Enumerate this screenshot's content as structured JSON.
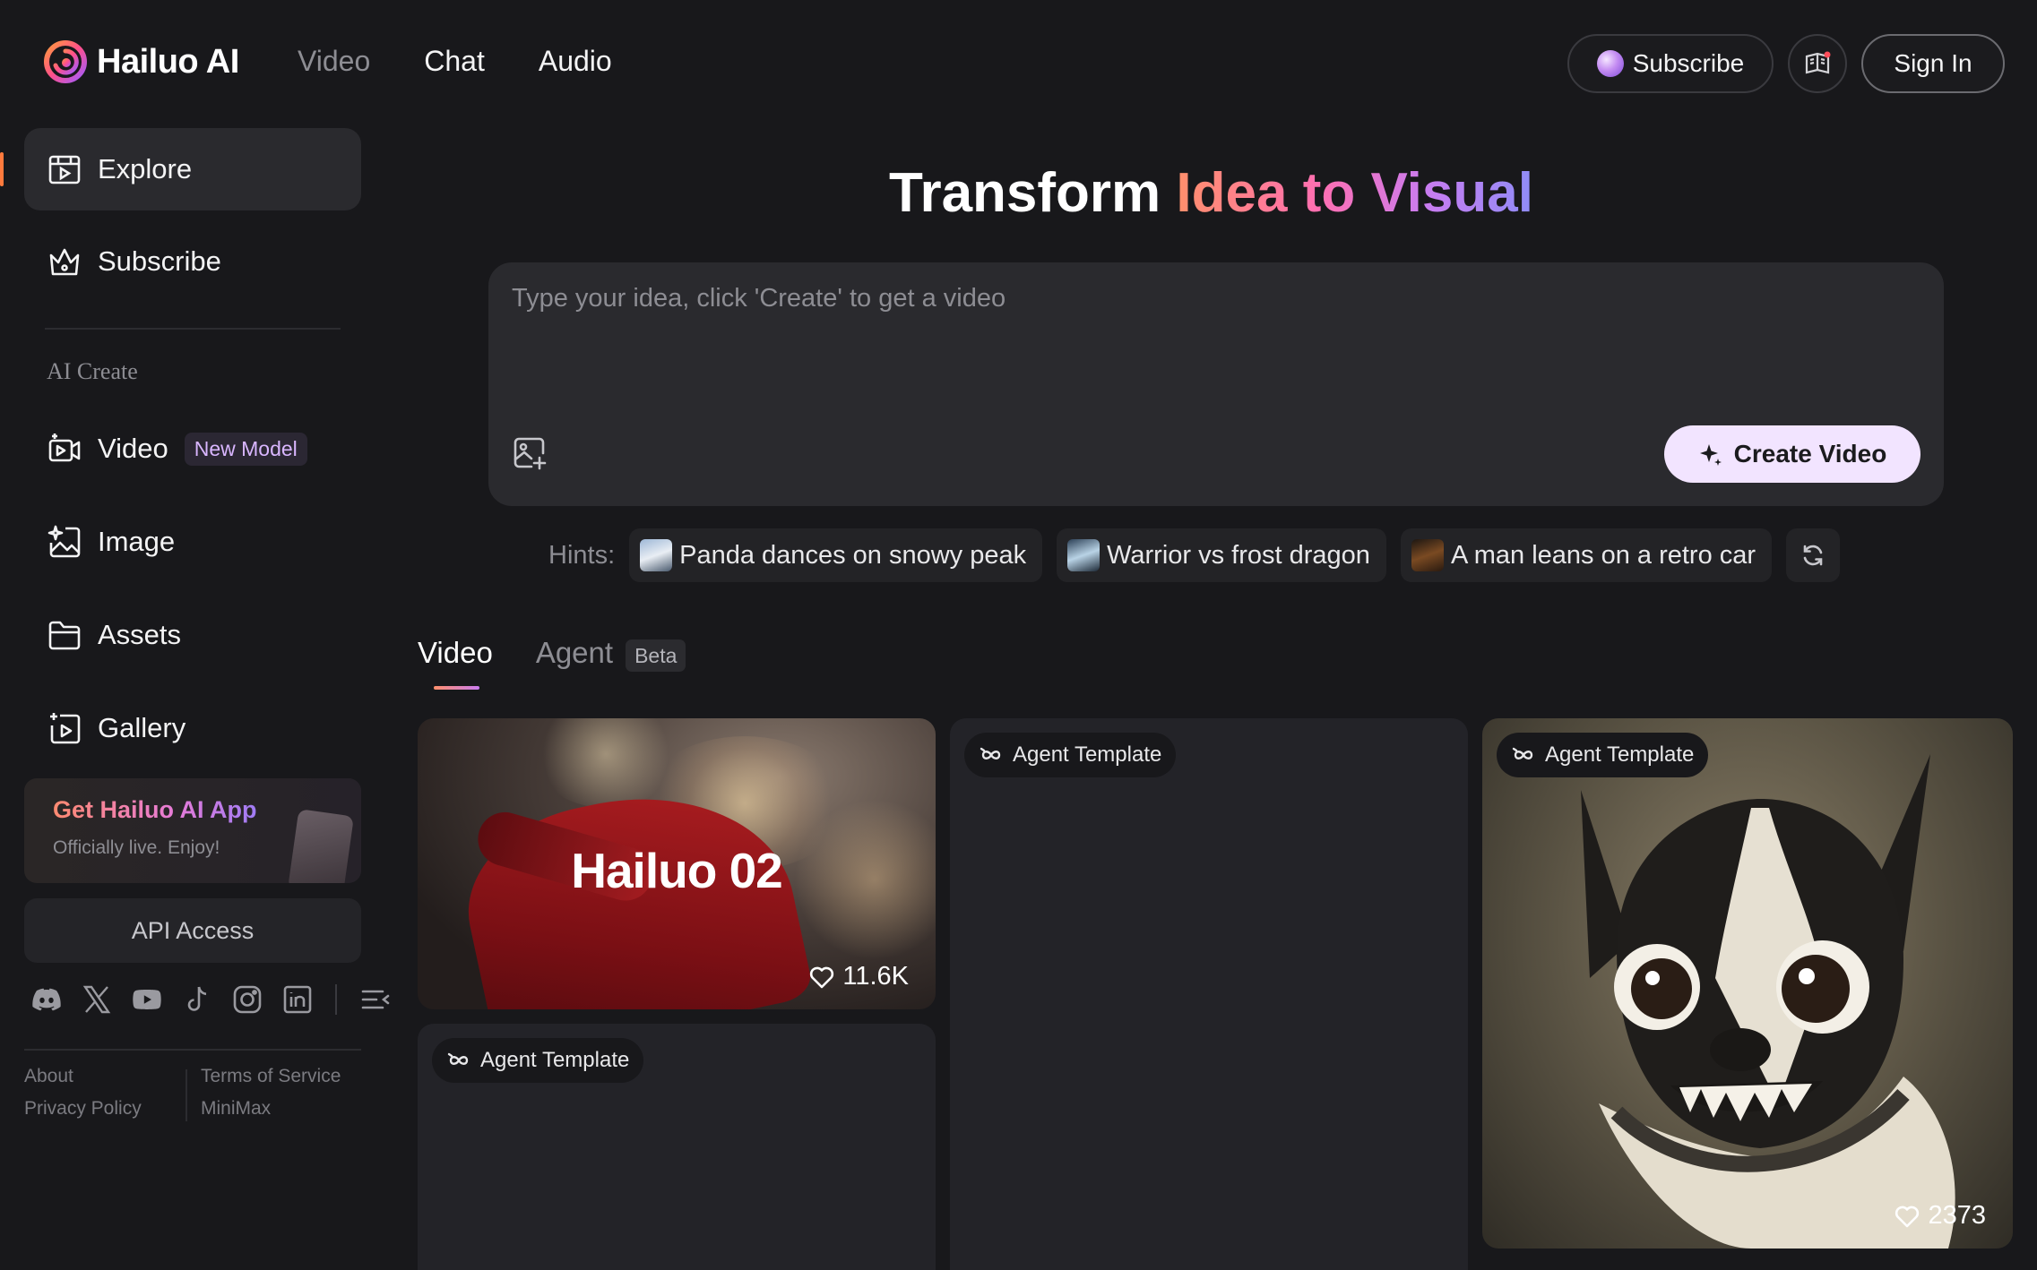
{
  "app": {
    "name": "Hailuo AI"
  },
  "topnav": [
    "Video",
    "Chat",
    "Audio"
  ],
  "header": {
    "subscribe_label": "Subscribe",
    "sign_in_label": "Sign In"
  },
  "sidebar": {
    "items": [
      {
        "label": "Explore"
      },
      {
        "label": "Subscribe"
      }
    ],
    "section_label": "AI Create",
    "create_items": [
      {
        "label": "Video",
        "badge": "New Model"
      },
      {
        "label": "Image"
      },
      {
        "label": "Assets"
      },
      {
        "label": "Gallery"
      }
    ],
    "app_promo": {
      "title": "Get Hailuo AI App",
      "subtitle": "Officially live. Enjoy!"
    },
    "api_label": "API Access",
    "footer": {
      "about": "About",
      "terms": "Terms of Service",
      "privacy": "Privacy Policy",
      "company": "MiniMax"
    }
  },
  "hero": {
    "title_plain": "Transform ",
    "title_gradient": "Idea to Visual"
  },
  "prompt": {
    "placeholder": "Type your idea, click 'Create' to get a video",
    "value": "",
    "create_label": "Create Video"
  },
  "hints": {
    "label": "Hints:",
    "items": [
      {
        "text": "Panda dances on snowy peak"
      },
      {
        "text": "Warrior vs frost dragon"
      },
      {
        "text": "A man leans on a retro car"
      }
    ]
  },
  "tabs": [
    {
      "label": "Video"
    },
    {
      "label": "Agent",
      "badge": "Beta"
    }
  ],
  "cards": [
    {
      "brand": "Hailuo 02",
      "likes": "11.6K"
    },
    {
      "tag": "Agent Template"
    },
    {
      "tag": "Agent Template"
    },
    {
      "tag": "Agent Template",
      "likes": "2373"
    }
  ],
  "colors": {
    "background": "#18181b",
    "accent_start": "#ff8f6b",
    "accent_end": "#8f8cf7",
    "create_button": "#f2e4ff"
  },
  "icons": {
    "sidebar": [
      "calendar-play-icon",
      "crown-icon",
      "video-add-icon",
      "image-sparkle-icon",
      "folder-icon",
      "gallery-play-icon"
    ],
    "socials": [
      "discord-icon",
      "x-icon",
      "youtube-icon",
      "tiktok-icon",
      "instagram-icon",
      "linkedin-icon",
      "collapse-icon"
    ]
  }
}
